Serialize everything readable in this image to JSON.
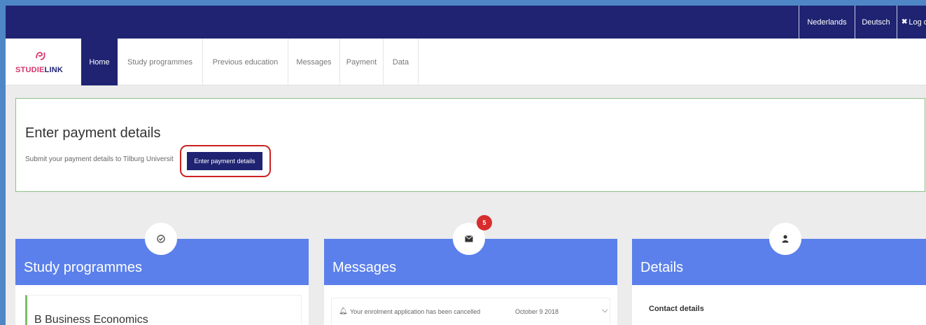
{
  "languages": {
    "dutch": "Nederlands",
    "german": "Deutsch",
    "logout": "Log o"
  },
  "logo": {
    "part1": "STUDIE",
    "part2": "LINK"
  },
  "nav": {
    "tabs": [
      {
        "label": "Home",
        "active": true
      },
      {
        "label": "Study programmes"
      },
      {
        "label": "Previous education"
      },
      {
        "label": "Messages"
      },
      {
        "label": "Payment"
      },
      {
        "label": "Data"
      }
    ]
  },
  "notice": {
    "title": "Enter payment details",
    "text": "Submit your payment details to Tilburg Universit",
    "button": "Enter payment details"
  },
  "cards": {
    "study": {
      "title": "Study programmes",
      "item": "B Business Economics"
    },
    "messages": {
      "title": "Messages",
      "badge": "5",
      "row_text": "Your enrolment application has been cancelled",
      "row_date": "October 9 2018"
    },
    "details": {
      "title": "Details",
      "section": "Contact details"
    }
  },
  "colors": {
    "navy": "#1f2372",
    "card_blue": "#5b80eb",
    "accent_red": "#cc2222",
    "brand_pink": "#d6336c"
  },
  "icons": {
    "study": "check-circle-icon",
    "messages": "envelope-icon",
    "details": "user-icon"
  }
}
